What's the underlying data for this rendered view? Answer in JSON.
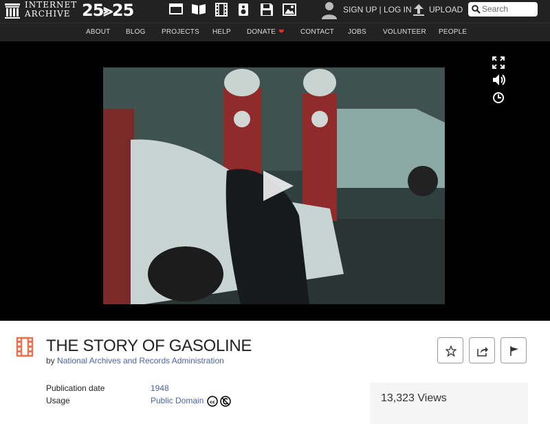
{
  "header": {
    "logo_line1": "INTERNET",
    "logo_line2": "ARCHIVE",
    "anniversary": "25⪢25",
    "signup_label": "SIGN UP",
    "separator": "|",
    "login_label": "LOG IN",
    "upload_label": "UPLOAD",
    "search_placeholder": "Search"
  },
  "nav": {
    "items": [
      "ABOUT",
      "BLOG",
      "PROJECTS",
      "HELP",
      "DONATE",
      "CONTACT",
      "JOBS",
      "VOLUNTEER",
      "PEOPLE"
    ],
    "donate_heart": "❤",
    "heart_color": "#e03131"
  },
  "player": {
    "controls": [
      "fullscreen-icon",
      "volume-icon",
      "clock-icon"
    ],
    "play_icon": "play-icon"
  },
  "item": {
    "media_type_icon": "film-icon",
    "title": "THE STORY OF GASOLINE",
    "by_prefix": "by",
    "creator": "National Archives and Records Administration",
    "actions": [
      "favorite-star-icon",
      "share-icon",
      "flag-icon"
    ],
    "metadata": [
      {
        "label": "Publication date",
        "value": "1948"
      },
      {
        "label": "Usage",
        "value": "Public Domain"
      }
    ],
    "license_icons": [
      "cc-icon",
      "public-domain-icon"
    ],
    "views": "13,323 Views",
    "link_color": "#4b64a4",
    "accent_color": "#e8744f"
  }
}
